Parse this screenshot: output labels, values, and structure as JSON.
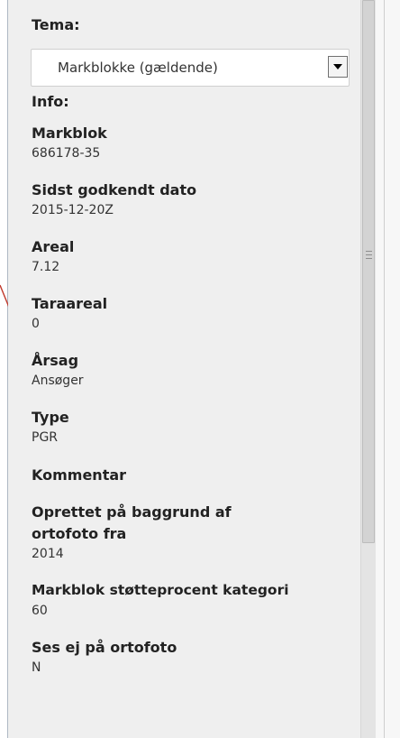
{
  "panel": {
    "tema_label": "Tema:",
    "select_value": "Markblokke (gældende)",
    "info_label": "Info:"
  },
  "fields": [
    {
      "label": "Markblok",
      "value": "686178-35"
    },
    {
      "label": "Sidst godkendt dato",
      "value": "2015-12-20Z"
    },
    {
      "label": "Areal",
      "value": "7.12"
    },
    {
      "label": "Taraareal",
      "value": "0"
    },
    {
      "label": "Årsag",
      "value": "Ansøger"
    },
    {
      "label": "Type",
      "value": "PGR"
    },
    {
      "label": "Kommentar",
      "value": ""
    },
    {
      "label_line1": "Oprettet på baggrund af",
      "label_line2": "ortofoto fra",
      "value": "2014"
    },
    {
      "label": "Markblok støtteprocent kategori",
      "value": "60"
    },
    {
      "label": "Ses ej på ortofoto",
      "value": "N"
    }
  ],
  "icons": {
    "select_arrow": "chevron-down-icon",
    "scroll_grip": "grip-icon"
  },
  "colors": {
    "panel_bg": "#efefef",
    "border": "#aeb8c4",
    "annotation": "#c0392b"
  }
}
